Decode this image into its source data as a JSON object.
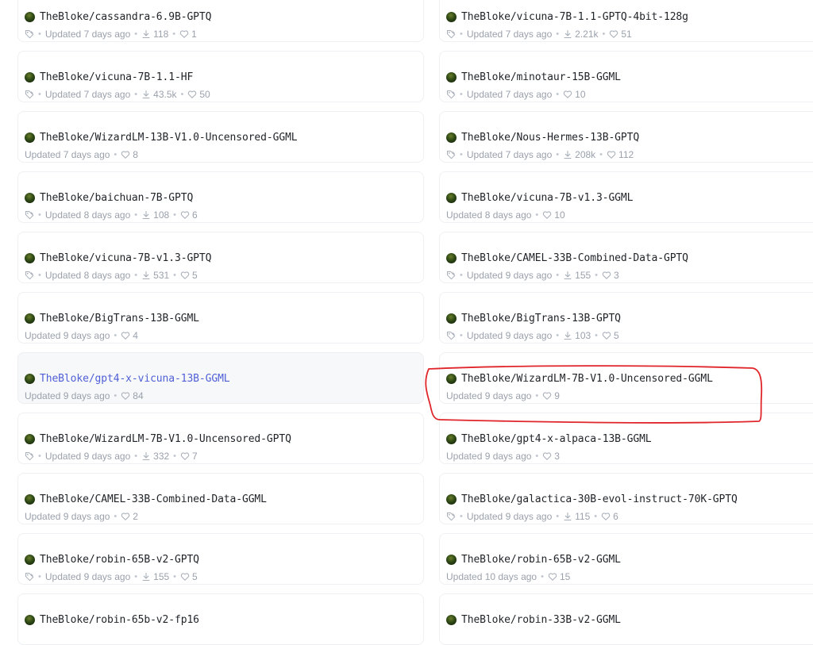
{
  "models": [
    {
      "name": "TheBloke/cassandra-6.9B-GPTQ",
      "task_icon": "text-generation-icon",
      "updated": "Updated 7 days ago",
      "downloads": "118",
      "likes": "1"
    },
    {
      "name": "TheBloke/vicuna-7B-1.1-GPTQ-4bit-128g",
      "task_icon": "text-generation-icon",
      "updated": "Updated 7 days ago",
      "downloads": "2.21k",
      "likes": "51"
    },
    {
      "name": "TheBloke/vicuna-7B-1.1-HF",
      "task_icon": "text-generation-icon",
      "updated": "Updated 7 days ago",
      "downloads": "43.5k",
      "likes": "50"
    },
    {
      "name": "TheBloke/minotaur-15B-GGML",
      "task_icon": "text-generation-icon",
      "updated": "Updated 7 days ago",
      "downloads": null,
      "likes": "10"
    },
    {
      "name": "TheBloke/WizardLM-13B-V1.0-Uncensored-GGML",
      "task_icon": null,
      "updated": "Updated 7 days ago",
      "downloads": null,
      "likes": "8"
    },
    {
      "name": "TheBloke/Nous-Hermes-13B-GPTQ",
      "task_icon": "text-generation-icon",
      "updated": "Updated 7 days ago",
      "downloads": "208k",
      "likes": "112"
    },
    {
      "name": "TheBloke/baichuan-7B-GPTQ",
      "task_icon": "text-generation-icon",
      "updated": "Updated 8 days ago",
      "downloads": "108",
      "likes": "6"
    },
    {
      "name": "TheBloke/vicuna-7B-v1.3-GGML",
      "task_icon": null,
      "updated": "Updated 8 days ago",
      "downloads": null,
      "likes": "10"
    },
    {
      "name": "TheBloke/vicuna-7B-v1.3-GPTQ",
      "task_icon": "text-generation-icon",
      "updated": "Updated 8 days ago",
      "downloads": "531",
      "likes": "5"
    },
    {
      "name": "TheBloke/CAMEL-33B-Combined-Data-GPTQ",
      "task_icon": "text-generation-icon",
      "updated": "Updated 9 days ago",
      "downloads": "155",
      "likes": "3"
    },
    {
      "name": "TheBloke/BigTrans-13B-GGML",
      "task_icon": null,
      "updated": "Updated 9 days ago",
      "downloads": null,
      "likes": "4"
    },
    {
      "name": "TheBloke/BigTrans-13B-GPTQ",
      "task_icon": "text-generation-icon",
      "updated": "Updated 9 days ago",
      "downloads": "103",
      "likes": "5"
    },
    {
      "name": "TheBloke/gpt4-x-vicuna-13B-GGML",
      "task_icon": null,
      "updated": "Updated 9 days ago",
      "downloads": null,
      "likes": "84",
      "hovered": true
    },
    {
      "name": "TheBloke/WizardLM-7B-V1.0-Uncensored-GGML",
      "task_icon": null,
      "updated": "Updated 9 days ago",
      "downloads": null,
      "likes": "9",
      "annotated": true
    },
    {
      "name": "TheBloke/WizardLM-7B-V1.0-Uncensored-GPTQ",
      "task_icon": "text-generation-icon",
      "updated": "Updated 9 days ago",
      "downloads": "332",
      "likes": "7"
    },
    {
      "name": "TheBloke/gpt4-x-alpaca-13B-GGML",
      "task_icon": null,
      "updated": "Updated 9 days ago",
      "downloads": null,
      "likes": "3"
    },
    {
      "name": "TheBloke/CAMEL-33B-Combined-Data-GGML",
      "task_icon": null,
      "updated": "Updated 9 days ago",
      "downloads": null,
      "likes": "2"
    },
    {
      "name": "TheBloke/galactica-30B-evol-instruct-70K-GPTQ",
      "task_icon": "text-generation-icon",
      "updated": "Updated 9 days ago",
      "downloads": "115",
      "likes": "6"
    },
    {
      "name": "TheBloke/robin-65B-v2-GPTQ",
      "task_icon": "text-generation-icon",
      "updated": "Updated 9 days ago",
      "downloads": "155",
      "likes": "5"
    },
    {
      "name": "TheBloke/robin-65B-v2-GGML",
      "task_icon": null,
      "updated": "Updated 10 days ago",
      "downloads": null,
      "likes": "15"
    },
    {
      "name": "TheBloke/robin-65b-v2-fp16",
      "task_icon": null,
      "updated": "",
      "downloads": null,
      "likes": null
    },
    {
      "name": "TheBloke/robin-33B-v2-GGML",
      "task_icon": null,
      "updated": "",
      "downloads": null,
      "likes": null
    }
  ],
  "colors": {
    "text": "#1f2328",
    "meta": "#9aa1ac",
    "hover_link": "#4f5fd6",
    "annotation": "#e0262b"
  }
}
